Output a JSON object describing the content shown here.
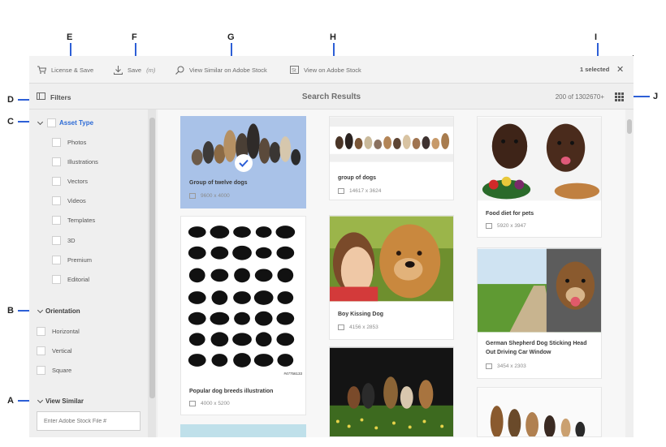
{
  "toolbar": {
    "license_save": "License & Save",
    "save": "Save",
    "save_shortcut": "(m)",
    "view_similar": "View Similar on Adobe Stock",
    "view_on_stock": "View on Adobe Stock",
    "selected": "1 selected",
    "close_glyph": "✕"
  },
  "subbar": {
    "filters": "Filters",
    "title": "Search Results",
    "count": "200 of 1302670+"
  },
  "sidebar": {
    "asset_type": "Asset Type",
    "asset_types": [
      "Photos",
      "Illustrations",
      "Vectors",
      "Videos",
      "Templates",
      "3D",
      "Premium",
      "Editorial"
    ],
    "orientation": "Orientation",
    "orientations": [
      "Horizontal",
      "Vertical",
      "Square"
    ],
    "view_similar": "View Similar",
    "stock_placeholder": "Enter Adobe Stock File #"
  },
  "cards": [
    {
      "title": "Group of twelve dogs",
      "dims": "9600 x 4000",
      "selected": true
    },
    {
      "title": "Popular dog breeds illustration",
      "dims": "4000 x 5200",
      "selected": false
    },
    {
      "title": "group of dogs",
      "dims": "14617 x 3624",
      "selected": false
    },
    {
      "title": "Boy Kissing Dog",
      "dims": "4156 x 2853",
      "selected": false
    },
    {
      "title": "Food diet for pets",
      "dims": "5920 x 3947",
      "selected": false
    },
    {
      "title": "German Shepherd Dog Sticking Head Out Driving Car Window",
      "dims": "3454 x 2303",
      "selected": false
    }
  ],
  "illustration_id": "#47756133",
  "callouts": {
    "a": "A",
    "b": "B",
    "c": "C",
    "d": "D",
    "e": "E",
    "f": "F",
    "g": "G",
    "h": "H",
    "i": "I",
    "j": "J"
  },
  "colors": {
    "accent": "#2d5fd6",
    "selected_card": "#a9c2e8",
    "panel": "#f5f5f5"
  }
}
